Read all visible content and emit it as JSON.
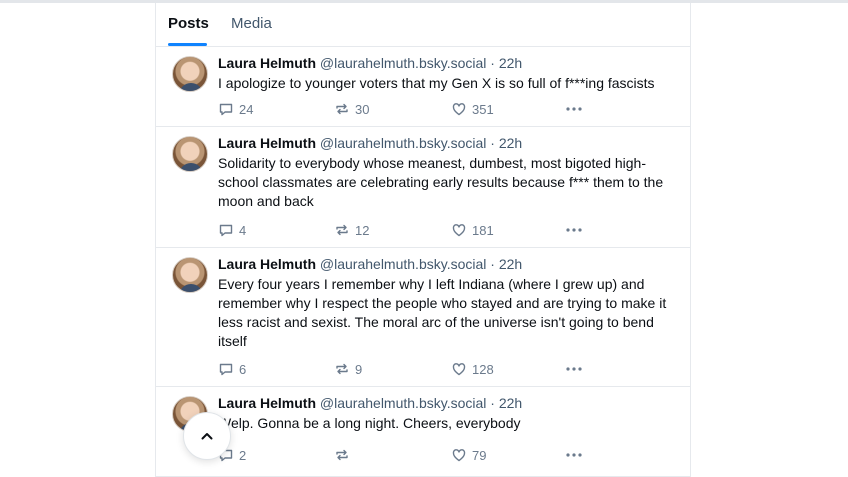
{
  "tabs": [
    {
      "label": "Posts",
      "active": true
    },
    {
      "label": "Media",
      "active": false
    }
  ],
  "posts": [
    {
      "author": "Laura Helmuth",
      "handle": "@laurahelmuth.bsky.social",
      "separator": "·",
      "time": "22h",
      "text": "I apologize to younger voters that my Gen X is so full of f***ing fascists",
      "replies": "24",
      "reposts": "30",
      "likes": "351"
    },
    {
      "author": "Laura Helmuth",
      "handle": "@laurahelmuth.bsky.social",
      "separator": "·",
      "time": "22h",
      "text": "Solidarity to everybody whose meanest, dumbest, most bigoted high-school classmates are celebrating early results because f*** them to the moon and back",
      "replies": "4",
      "reposts": "12",
      "likes": "181"
    },
    {
      "author": "Laura Helmuth",
      "handle": "@laurahelmuth.bsky.social",
      "separator": "·",
      "time": "22h",
      "text": "Every four years I remember why I left Indiana (where I grew up) and remember why I respect the people who stayed and are trying to make it less racist and sexist. The moral arc of the universe isn't going to bend itself",
      "replies": "6",
      "reposts": "9",
      "likes": "128"
    },
    {
      "author": "Laura Helmuth",
      "handle": "@laurahelmuth.bsky.social",
      "separator": "·",
      "time": "22h",
      "text": "Welp. Gonna be a long night. Cheers, everybody",
      "replies": "2",
      "reposts": "",
      "likes": "79"
    }
  ],
  "colors": {
    "accent": "#1083fe",
    "muted_text": "#42576c",
    "icon": "#6b7a8c",
    "border": "#e6e9ed"
  },
  "icons": {
    "reply": "speech-bubble-icon",
    "repost": "repost-arrows-icon",
    "like": "heart-icon",
    "more": "ellipsis-icon",
    "scroll_top": "chevron-up-icon"
  }
}
